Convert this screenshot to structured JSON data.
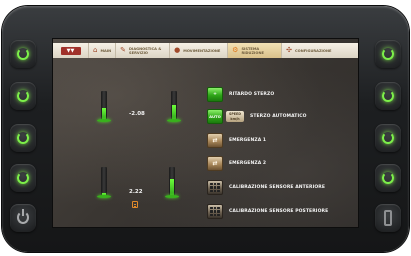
{
  "side_keys": {
    "left": [
      "softkey-1",
      "softkey-2",
      "softkey-3",
      "softkey-4",
      "power"
    ],
    "right": [
      "softkey-5",
      "softkey-6",
      "softkey-7",
      "softkey-8",
      "usb-port"
    ]
  },
  "topbar": {
    "logo_text": "",
    "tabs": [
      {
        "label": "MAIN",
        "icon": "home-icon"
      },
      {
        "label": "DIAGNOSTICA &\nSERVIZIO",
        "icon": "wrench-icon"
      },
      {
        "label": "MOVIMENTAZIONE",
        "icon": "drop-icon"
      },
      {
        "label": "SISTEMA\nRIDUZIONE",
        "icon": "gear-icon",
        "active": true
      },
      {
        "label": "CONFIGURAZIONE",
        "icon": "fan-icon"
      }
    ]
  },
  "gauges": {
    "top_reading": "-2.08",
    "bottom_reading": "2.22",
    "levels": [
      0.45,
      0.55,
      0.15,
      0.6
    ]
  },
  "menu": [
    {
      "label": "RITARDO STERZO",
      "button_text": "+",
      "style": "green"
    },
    {
      "label": "STERZO AUTOMATICO",
      "button_text": "AUTO",
      "speed_text": "SPEED\nkm/h",
      "style": "green"
    },
    {
      "label": "EMERGENZA 1",
      "button_text": "",
      "style": "bronze"
    },
    {
      "label": "EMERGENZA 2",
      "button_text": "",
      "style": "bronze"
    },
    {
      "label": "CALIBRAZIONE SENSORE ANTERIORE",
      "style": "grid"
    },
    {
      "label": "CALIBRAZIONE SENSORE POSTERIORE",
      "style": "grid"
    }
  ],
  "colors": {
    "accent_green": "#2fa619",
    "active_tab": "#d9c08a",
    "warning_orange": "#e08a2b"
  }
}
